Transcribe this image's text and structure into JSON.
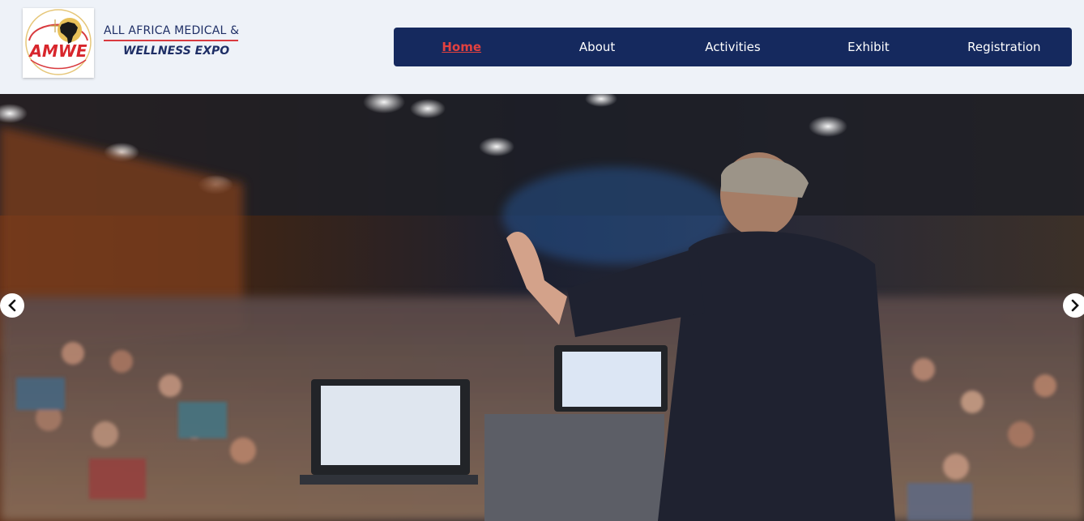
{
  "brand": {
    "logo_text": "AMWE",
    "name_line1": "ALL AFRICA MEDICAL &",
    "name_line2": "WELLNESS EXPO"
  },
  "nav": {
    "items": [
      {
        "label": "Home",
        "active": true
      },
      {
        "label": "About",
        "active": false
      },
      {
        "label": "Activities",
        "active": false
      },
      {
        "label": "Exhibit",
        "active": false
      },
      {
        "label": "Registration",
        "active": false
      }
    ]
  },
  "hero": {
    "image": "conference-speaker-photo",
    "prev_icon": "chevron-left-icon",
    "next_icon": "chevron-right-icon"
  },
  "colors": {
    "nav_bg": "#15295e",
    "accent_red": "#e2413f",
    "brand_blue": "#1f2f66",
    "header_bg": "#eef2f8"
  }
}
